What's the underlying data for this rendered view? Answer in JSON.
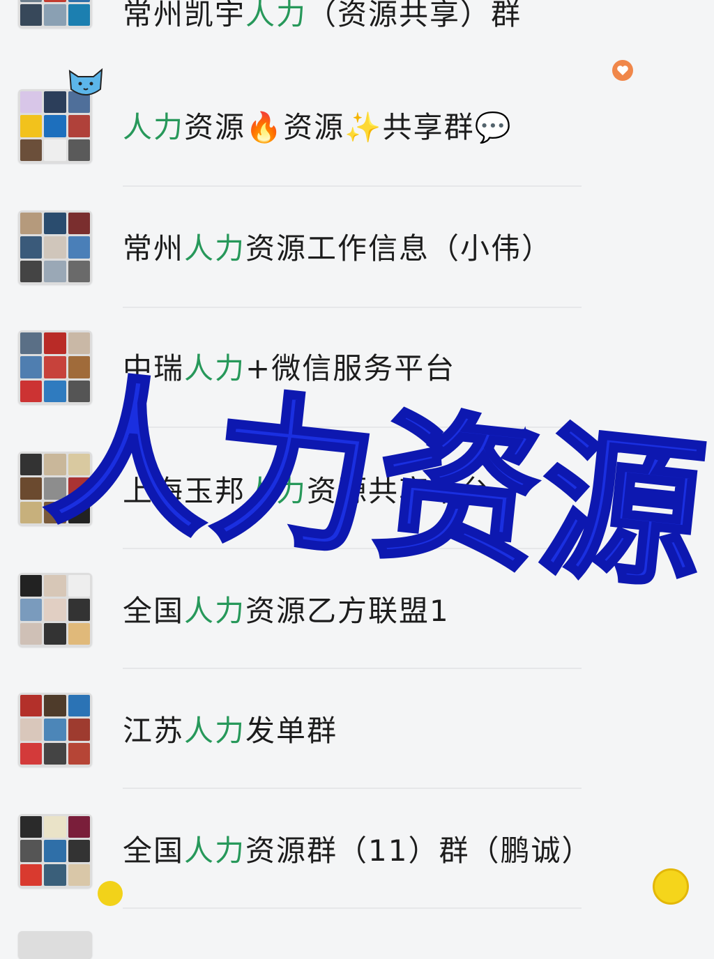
{
  "chats": [
    {
      "prefix": "常州凯宇",
      "highlight": "人力",
      "suffix": "（资源共享）群"
    },
    {
      "prefix": "",
      "highlight": "人力",
      "suffix": "资源🔥资源✨共享群💬"
    },
    {
      "prefix": "常州",
      "highlight": "人力",
      "suffix": "资源工作信息（小伟）"
    },
    {
      "prefix": "中瑞",
      "highlight": "人力",
      "suffix": "+微信服务平台"
    },
    {
      "prefix": "上海玉邦",
      "highlight": "人力",
      "suffix": "资源共享平台"
    },
    {
      "prefix": "全国",
      "highlight": "人力",
      "suffix": "资源乙方联盟1"
    },
    {
      "prefix": "江苏",
      "highlight": "人力",
      "suffix": "发单群"
    },
    {
      "prefix": "全国",
      "highlight": "人力",
      "suffix": "资源群（11）群（鹏诚）"
    }
  ],
  "overlay_text": "人力资源",
  "colors": {
    "highlight": "#27985a",
    "overlay": "#1a2fe0"
  },
  "decorations": [
    "heart-icon",
    "cat-sticker-icon",
    "sun-badge-icon",
    "lemon-icon"
  ]
}
